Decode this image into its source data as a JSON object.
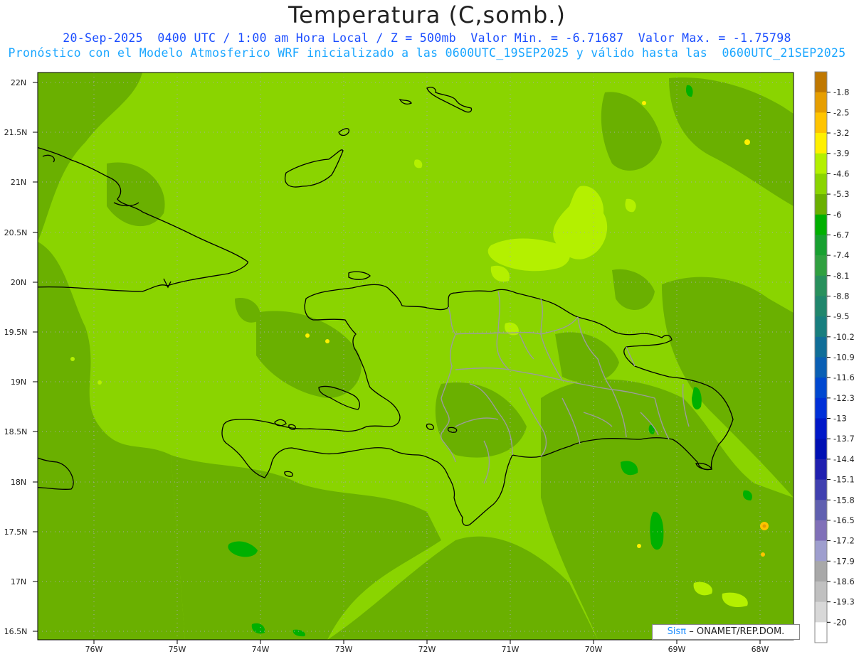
{
  "header": {
    "title": "Temperatura (C,somb.)",
    "line1": "20-Sep-2025  0400 UTC / 1:00 am Hora Local / Z = 500mb  Valor Min. = -6.71687  Valor Max. = -1.75798",
    "line2": "Pronóstico con el Modelo Atmosferico WRF inicializado a las 0600UTC_19SEP2025 y válido hasta las  0600UTC_21SEP2025"
  },
  "axes": {
    "lat_labels": [
      "22N",
      "21.5N",
      "21N",
      "20.5N",
      "20N",
      "19.5N",
      "19N",
      "18.5N",
      "18N",
      "17.5N",
      "17N",
      "16.5N"
    ],
    "lon_labels": [
      "76W",
      "75W",
      "74W",
      "73W",
      "72W",
      "71W",
      "70W",
      "69W",
      "68W"
    ]
  },
  "colorbar": {
    "labels": [
      "-1.8",
      "-2.5",
      "-3.2",
      "-3.9",
      "-4.6",
      "-5.3",
      "-6",
      "-6.7",
      "-7.4",
      "-8.1",
      "-8.8",
      "-9.5",
      "-10.2",
      "-10.9",
      "-11.6",
      "-12.3",
      "-13",
      "-13.7",
      "-14.4",
      "-15.1",
      "-15.8",
      "-16.5",
      "-17.2",
      "-17.9",
      "-18.6",
      "-19.3",
      "-20"
    ],
    "colors": [
      "#c07800",
      "#e69e00",
      "#ffc400",
      "#fff000",
      "#b4f000",
      "#8ad400",
      "#6ab000",
      "#00b000",
      "#18a030",
      "#30a040",
      "#28905c",
      "#20866c",
      "#187e7e",
      "#106e98",
      "#0a5fb4",
      "#0048d0",
      "#0030d8",
      "#0018c8",
      "#0010b4",
      "#2020b0",
      "#4040b0",
      "#6060b0",
      "#8070b8",
      "#9e9ece",
      "#a8a8a8",
      "#c0c0c0",
      "#d8d8d8",
      "#ffffff"
    ]
  },
  "colors": {
    "base_field": "#8ad400",
    "darker_field": "#6ab000",
    "lighter_field": "#b4f000",
    "warm_spot": "#ffc400"
  },
  "credit": {
    "brand": "Sisπ",
    "text": "– ONAMET/REP.DOM."
  }
}
